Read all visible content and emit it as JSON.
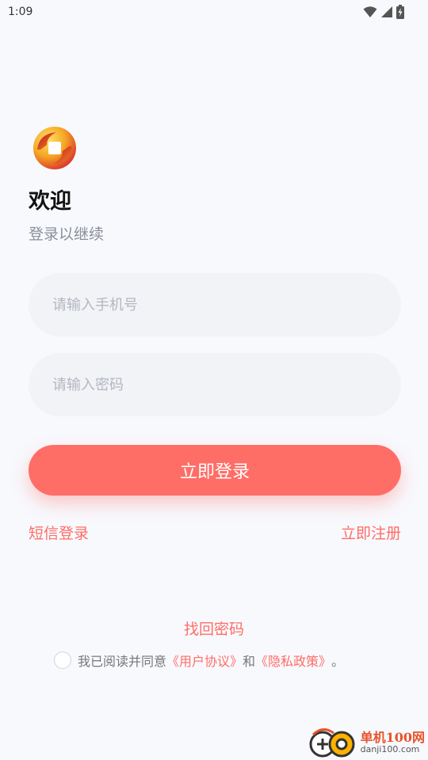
{
  "status_bar": {
    "time": "1:09"
  },
  "header": {
    "title": "欢迎",
    "subtitle": "登录以继续"
  },
  "form": {
    "phone_placeholder": "请输入手机号",
    "password_placeholder": "请输入密码",
    "login_label": "立即登录"
  },
  "links": {
    "sms_login": "短信登录",
    "register": "立即注册",
    "forgot_password": "找回密码"
  },
  "agreement": {
    "prefix": "我已阅读并同意",
    "user_agreement": "《用户协议》",
    "and": "和",
    "privacy_policy": "《隐私政策》",
    "suffix": "。"
  },
  "watermark": {
    "title": "单机100网",
    "url": "danji100.com"
  },
  "colors": {
    "accent": "#ff6d67",
    "background": "#f8f9fd",
    "field": "#f1f3f7"
  }
}
